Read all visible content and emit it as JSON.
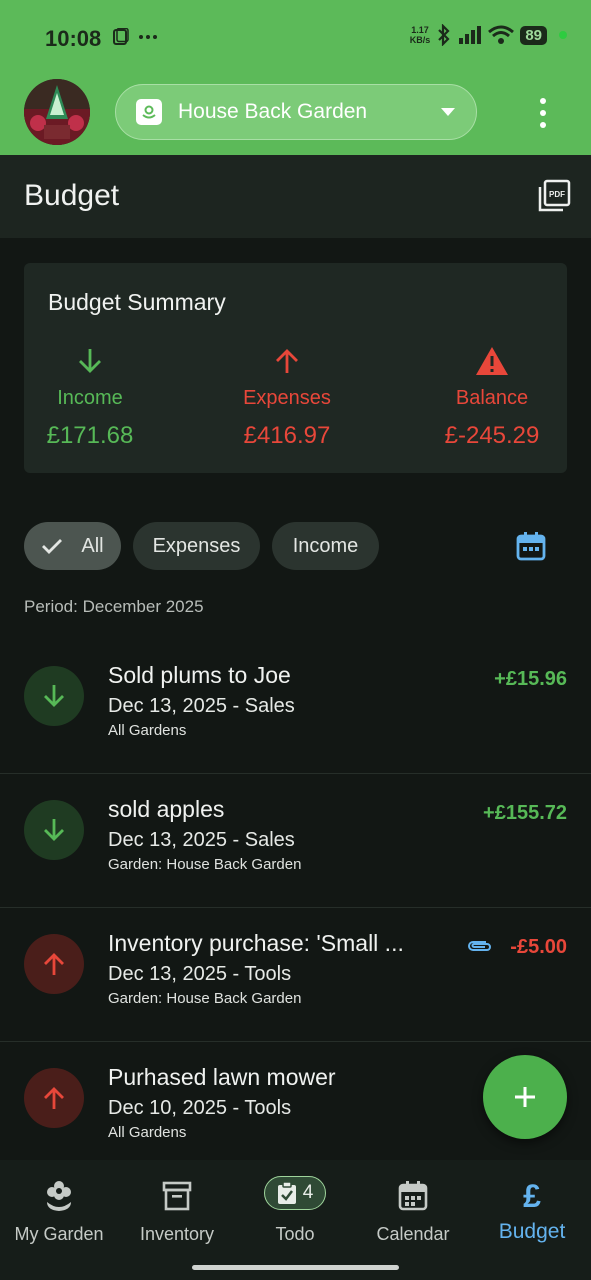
{
  "status_bar": {
    "time": "10:08",
    "net_speed_value": "1.17",
    "net_speed_unit": "KB/s",
    "battery": "89"
  },
  "header": {
    "garden_selector": "House Back Garden"
  },
  "title_bar": {
    "title": "Budget"
  },
  "summary": {
    "title": "Budget Summary",
    "income_label": "Income",
    "income_value": "£171.68",
    "expenses_label": "Expenses",
    "expenses_value": "£416.97",
    "balance_label": "Balance",
    "balance_value": "£-245.29"
  },
  "filters": {
    "all": "All",
    "expenses": "Expenses",
    "income": "Income"
  },
  "period": "Period: December 2025",
  "transactions": [
    {
      "title": "Sold plums to Joe",
      "subtitle": "Dec 13, 2025 - Sales",
      "garden": "All Gardens",
      "amount": "+£15.96",
      "type": "income"
    },
    {
      "title": "sold apples",
      "subtitle": "Dec 13, 2025 - Sales",
      "garden": "Garden: House Back Garden",
      "amount": "+£155.72",
      "type": "income"
    },
    {
      "title": "Inventory purchase: 'Small ...",
      "subtitle": "Dec 13, 2025 - Tools",
      "garden": "Garden: House Back Garden",
      "amount": "-£5.00",
      "type": "expense",
      "attachment": true
    },
    {
      "title": "Purhased lawn mower",
      "subtitle": "Dec 10, 2025 - Tools",
      "garden": "All Gardens",
      "amount": "",
      "type": "expense"
    }
  ],
  "bottom_nav": {
    "my_garden": "My Garden",
    "inventory": "Inventory",
    "todo": "Todo",
    "todo_count": "4",
    "calendar": "Calendar",
    "budget": "Budget"
  },
  "colors": {
    "header_green": "#5cba59",
    "income_green": "#57b957",
    "expense_red": "#e8473a",
    "active_blue": "#64b3ee",
    "fab_green": "#4cb04c"
  }
}
